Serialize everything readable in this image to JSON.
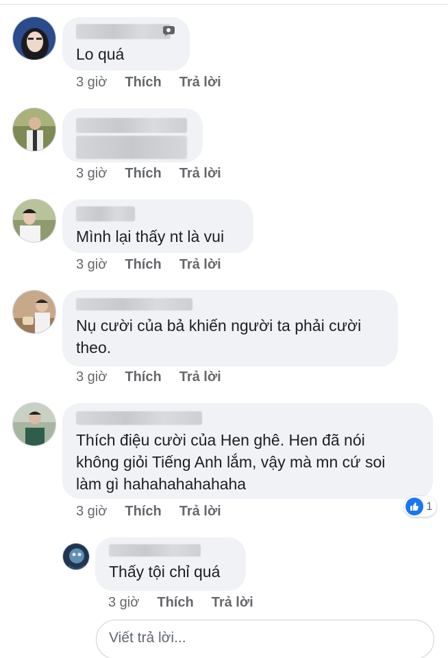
{
  "comments": [
    {
      "text": "Lo quá",
      "time": "3 giờ",
      "like_label": "Thích",
      "reply_label": "Trả lời"
    },
    {
      "text": "",
      "time": "3 giờ",
      "like_label": "Thích",
      "reply_label": "Trả lời"
    },
    {
      "text": "Mình lại thấy nt là vui",
      "time": "3 giờ",
      "like_label": "Thích",
      "reply_label": "Trả lời"
    },
    {
      "text": "Nụ cười của bả khiến người ta phải cười\ntheo.",
      "time": "3 giờ",
      "like_label": "Thích",
      "reply_label": "Trả lời"
    },
    {
      "text": "Thích điệu cười của Hen ghê. Hen đã nói\nkhông giỏi Tiếng Anh lắm, vậy mà mn cứ soi\nlàm gì hahahahahahaha",
      "time": "3 giờ",
      "like_label": "Thích",
      "reply_label": "Trả lời",
      "reaction_count": "1"
    }
  ],
  "reply": {
    "text": "Thấy tội chỉ quá",
    "time": "3 giờ",
    "like_label": "Thích",
    "reply_label": "Trả lời"
  },
  "reply_input": {
    "placeholder": "Viết trả lời..."
  },
  "colors": {
    "bubble": "#f0f2f5",
    "meta_text": "#65676b",
    "like_blue": "#1877f2"
  },
  "icons": {
    "reaction": "like-icon",
    "name_badge": "photo-comment-icon"
  }
}
